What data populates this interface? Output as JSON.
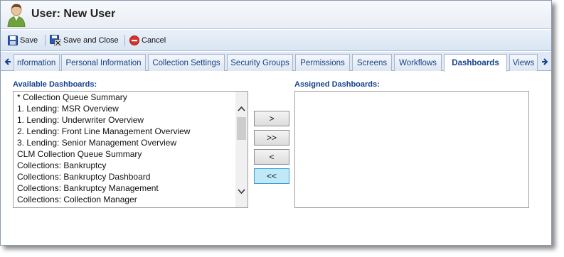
{
  "window": {
    "title": "User: New User"
  },
  "toolbar": {
    "save": "Save",
    "save_close": "Save and Close",
    "cancel": "Cancel"
  },
  "tabs": [
    {
      "label": "nformation"
    },
    {
      "label": "Personal Information"
    },
    {
      "label": "Collection Settings"
    },
    {
      "label": "Security Groups"
    },
    {
      "label": "Permissions"
    },
    {
      "label": "Screens"
    },
    {
      "label": "Workflows"
    },
    {
      "label": "Dashboards",
      "active": true
    },
    {
      "label": "Views"
    }
  ],
  "available": {
    "label": "Available Dashboards:",
    "items": [
      "* Collection Queue Summary",
      "1. Lending: MSR Overview",
      "1. Lending: Underwriter Overview",
      "2. Lending: Front Line Management Overview",
      "3. Lending: Senior Management Overview",
      "CLM Collection Queue Summary",
      "Collections: Bankruptcy",
      "Collections: Bankruptcy Dashboard",
      "Collections: Bankruptcy Management",
      "Collections: Collection Manager"
    ]
  },
  "assigned": {
    "label": "Assigned Dashboards:",
    "items": []
  },
  "buttons": {
    "add": ">",
    "add_all": ">>",
    "remove": "<",
    "remove_all": "<<"
  },
  "icons": {
    "user": "user-icon",
    "save": "floppy-disk-icon",
    "save_close": "floppy-disk-close-icon",
    "cancel": "cancel-circle-icon"
  },
  "colors": {
    "accent": "#15428b",
    "highlight_button": "#bfe9f8",
    "cancel_red": "#d9332b"
  }
}
